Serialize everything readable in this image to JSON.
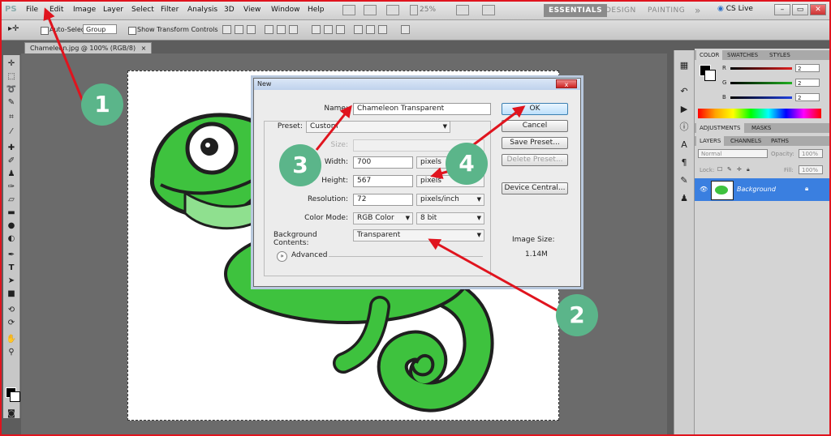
{
  "app": {
    "logo": "PS"
  },
  "menu": [
    "File",
    "Edit",
    "Image",
    "Layer",
    "Select",
    "Filter",
    "Analysis",
    "3D",
    "View",
    "Window",
    "Help"
  ],
  "menubar": {
    "zoom": "25%",
    "workspaces": [
      "ESSENTIALS",
      "DESIGN",
      "PAINTING"
    ],
    "more": "»",
    "cs_live": "CS Live"
  },
  "options_bar": {
    "auto_select_label": "Auto-Select:",
    "auto_select_value": "Group",
    "show_transform_label": "Show Transform Controls"
  },
  "document": {
    "tab_label": "Chameleon.jpg @ 100% (RGB/8)",
    "tab_close": "×"
  },
  "panels": {
    "color_tabs": [
      "COLOR",
      "SWATCHES",
      "STYLES"
    ],
    "sliders": [
      {
        "label": "R",
        "value": "2",
        "color": "#e02020"
      },
      {
        "label": "G",
        "value": "2",
        "color": "#20b020"
      },
      {
        "label": "B",
        "value": "2",
        "color": "#2040e0"
      }
    ],
    "adjustment_tabs": [
      "ADJUSTMENTS",
      "MASKS"
    ],
    "layer_tabs": [
      "LAYERS",
      "CHANNELS",
      "PATHS"
    ],
    "blend_mode": "Normal",
    "opacity_label": "Opacity:",
    "opacity_value": "100%",
    "lock_label": "Lock:",
    "fill_label": "Fill:",
    "fill_value": "100%",
    "layer_name": "Background"
  },
  "dialog": {
    "title": "New",
    "close": "x",
    "name_label": "Name:",
    "name_value": "Chameleon Transparent",
    "preset_label": "Preset:",
    "preset_value": "Custom",
    "size_label": "Size:",
    "width_label": "Width:",
    "width_value": "700",
    "width_unit": "pixels",
    "height_label": "Height:",
    "height_value": "567",
    "height_unit": "pixels",
    "resolution_label": "Resolution:",
    "resolution_value": "72",
    "resolution_unit": "pixels/inch",
    "color_mode_label": "Color Mode:",
    "color_mode_value": "RGB Color",
    "bit_depth_value": "8 bit",
    "bg_contents_label": "Background Contents:",
    "bg_contents_value": "Transparent",
    "advanced_label": "Advanced",
    "ok": "OK",
    "cancel": "Cancel",
    "save_preset": "Save Preset...",
    "delete_preset": "Delete Preset...",
    "device_central": "Device Central...",
    "image_size_label": "Image Size:",
    "image_size_value": "1.14M"
  },
  "callouts": [
    "1",
    "2",
    "3",
    "4"
  ],
  "colors": {
    "accent_red": "#e0141e",
    "callout_green": "#5bb58a",
    "chameleon_green": "#3ec23e"
  }
}
